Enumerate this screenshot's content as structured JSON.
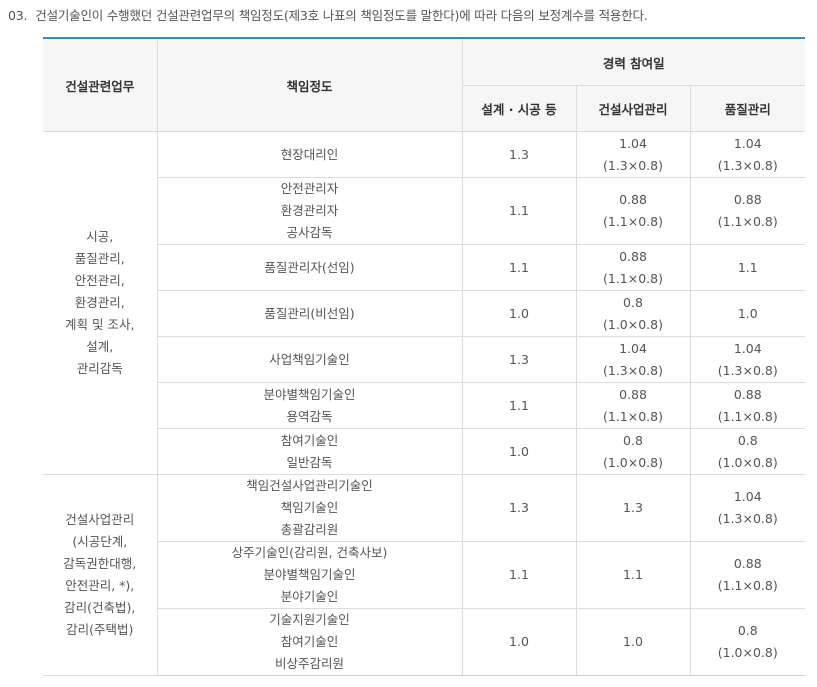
{
  "intro": {
    "number": "03.",
    "text": "건설기술인이 수행했던 건설관련업무의 책임정도(제3호 나표의 책임정도를 말한다)에 따라 다음의 보정계수를 적용한다."
  },
  "table": {
    "headers": {
      "col1": "건설관련업무",
      "col2": "책임정도",
      "group": "경력 참여일",
      "sub1": "설계 · 시공 등",
      "sub2": "건설사업관리",
      "sub3": "품질관리"
    },
    "group1": {
      "label": [
        "시공,",
        "품질관리,",
        "안전관리,",
        "환경관리,",
        "계획 및 조사,",
        "설계,",
        "관리감독"
      ],
      "rows": [
        {
          "role": [
            "현장대리인"
          ],
          "c1": "1.3",
          "c2": [
            "1.04",
            "(1.3×0.8)"
          ],
          "c3": [
            "1.04",
            "(1.3×0.8)"
          ]
        },
        {
          "role": [
            "안전관리자",
            "환경관리자",
            "공사감독"
          ],
          "c1": "1.1",
          "c2": [
            "0.88",
            "(1.1×0.8)"
          ],
          "c3": [
            "0.88",
            "(1.1×0.8)"
          ]
        },
        {
          "role": [
            "품질관리자(선임)"
          ],
          "c1": "1.1",
          "c2": [
            "0.88",
            "(1.1×0.8)"
          ],
          "c3": [
            "1.1"
          ]
        },
        {
          "role": [
            "품질관리(비선임)"
          ],
          "c1": "1.0",
          "c2": [
            "0.8",
            "(1.0×0.8)"
          ],
          "c3": [
            "1.0"
          ]
        },
        {
          "role": [
            "사업책임기술인"
          ],
          "c1": "1.3",
          "c2": [
            "1.04",
            "(1.3×0.8)"
          ],
          "c3": [
            "1.04",
            "(1.3×0.8)"
          ]
        },
        {
          "role": [
            "분야별책임기술인",
            "용역감독"
          ],
          "c1": "1.1",
          "c2": [
            "0.88",
            "(1.1×0.8)"
          ],
          "c3": [
            "0.88",
            "(1.1×0.8)"
          ]
        },
        {
          "role": [
            "참여기술인",
            "일반감독"
          ],
          "c1": "1.0",
          "c2": [
            "0.8",
            "(1.0×0.8)"
          ],
          "c3": [
            "0.8",
            "(1.0×0.8)"
          ]
        }
      ]
    },
    "group2": {
      "label": [
        "건설사업관리",
        "(시공단계,",
        "감독권한대행,",
        "안전관리, *),",
        "감리(건축법),",
        "감리(주택법)"
      ],
      "rows": [
        {
          "role": [
            "책임건설사업관리기술인",
            "책임기술인",
            "총괄감리원"
          ],
          "c1": "1.3",
          "c2": [
            "1.3"
          ],
          "c3": [
            "1.04",
            "(1.3×0.8)"
          ]
        },
        {
          "role": [
            "상주기술인(감리원, 건축사보)",
            "분야별책임기술인",
            "분야기술인"
          ],
          "c1": "1.1",
          "c2": [
            "1.1"
          ],
          "c3": [
            "0.88",
            "(1.1×0.8)"
          ]
        },
        {
          "role": [
            "기술지원기술인",
            "참여기술인",
            "비상주감리원"
          ],
          "c1": "1.0",
          "c2": [
            "1.0"
          ],
          "c3": [
            "0.8",
            "(1.0×0.8)"
          ]
        }
      ]
    }
  }
}
